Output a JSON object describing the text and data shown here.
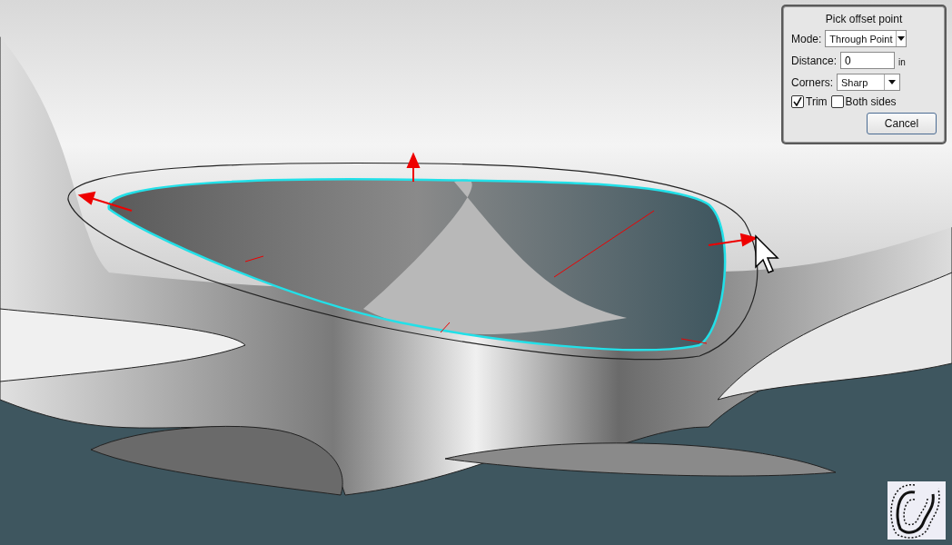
{
  "dialog": {
    "title": "Pick offset point",
    "fields": [
      {
        "kind": "select",
        "label": "Mode:",
        "value": "Through Point"
      },
      {
        "kind": "input",
        "label": "Distance:",
        "value": "0",
        "unit": "in"
      },
      {
        "kind": "select",
        "label": "Corners:",
        "value": "Sharp"
      }
    ],
    "options": [
      {
        "label": "Trim",
        "checked": true
      },
      {
        "label": "Both sides",
        "checked": false
      }
    ],
    "buttons": [
      "Cancel"
    ]
  }
}
